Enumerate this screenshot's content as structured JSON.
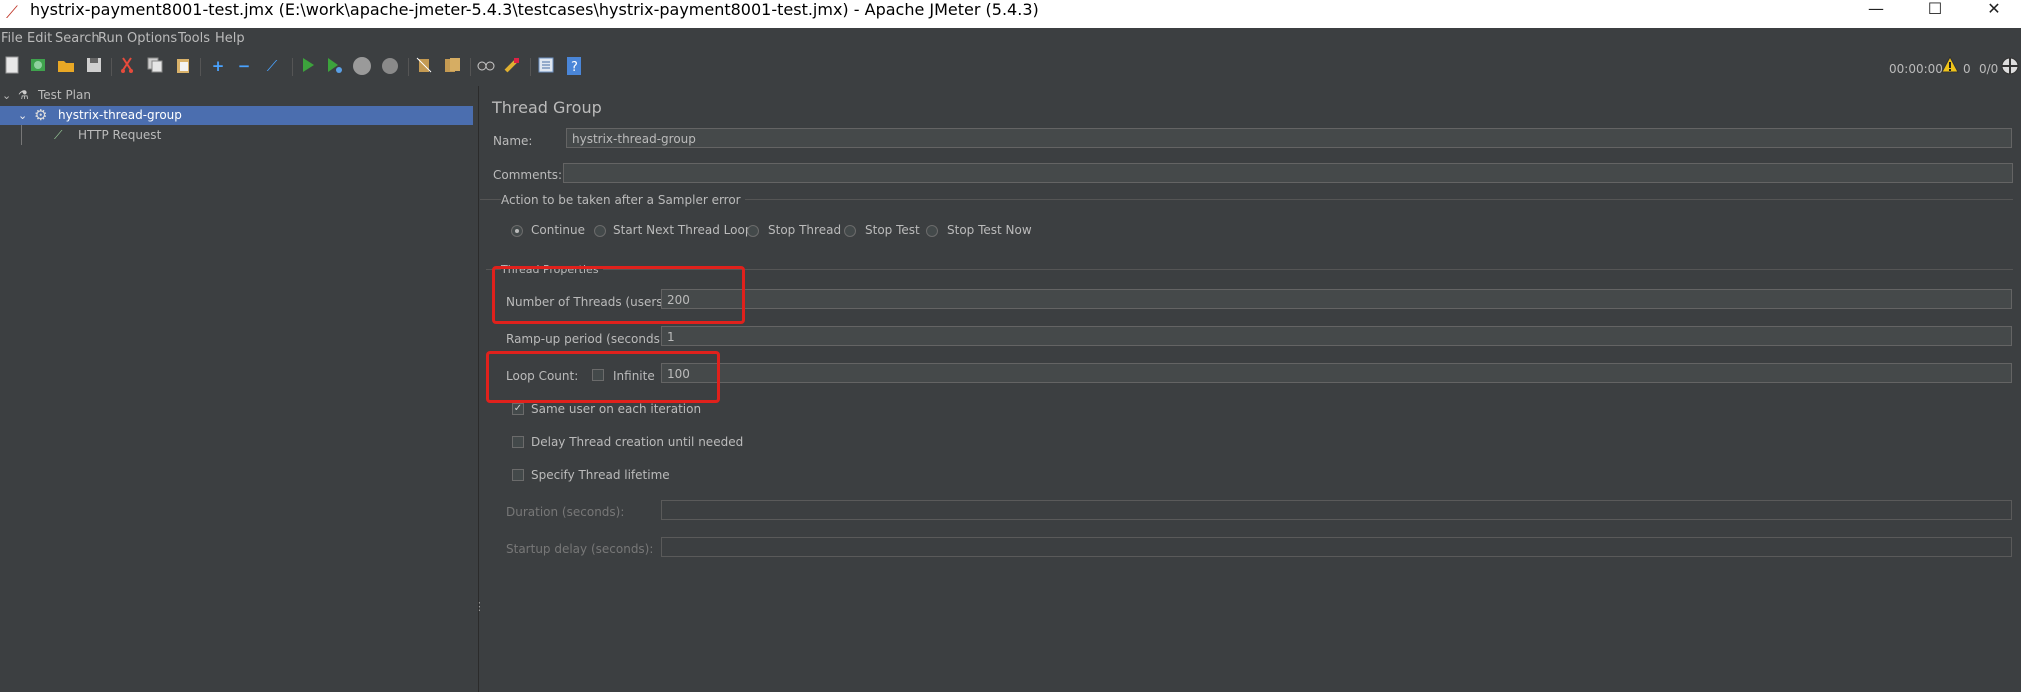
{
  "window": {
    "title": "hystrix-payment8001-test.jmx (E:\\work\\apache-jmeter-5.4.3\\testcases\\hystrix-payment8001-test.jmx) - Apache JMeter (5.4.3)",
    "minimize": "—",
    "maximize": "☐",
    "close": "✕"
  },
  "menu": {
    "file": "File",
    "edit": "Edit",
    "search": "Search",
    "run": "Run",
    "options": "Options",
    "tools": "Tools",
    "help": "Help"
  },
  "toolbar": {
    "icons": [
      "new-icon",
      "templates-icon",
      "open-icon",
      "save-icon",
      "cut-icon",
      "copy-icon",
      "paste-icon",
      "expand-icon",
      "collapse-icon",
      "toggle-icon",
      "start-icon",
      "start-no-pauses-icon",
      "stop-icon",
      "shutdown-icon",
      "clear-icon",
      "clear-all-icon",
      "search-icon",
      "reset-search-icon",
      "function-helper-icon",
      "help-icon"
    ],
    "timer": "00:00:00",
    "warning_count": "0",
    "threads": "0/0"
  },
  "tree": {
    "items": [
      {
        "label": "Test Plan"
      },
      {
        "label": "hystrix-thread-group"
      },
      {
        "label": "HTTP Request"
      }
    ]
  },
  "panel": {
    "title": "Thread Group",
    "name_label": "Name:",
    "name_value": "hystrix-thread-group",
    "comments_label": "Comments:",
    "comments_value": "",
    "action_title": "Action to be taken after a Sampler error",
    "actions": [
      "Continue",
      "Start Next Thread Loop",
      "Stop Thread",
      "Stop Test",
      "Stop Test Now"
    ],
    "selected_action": "Continue",
    "thread_props_title": "Thread Properties",
    "threads_label": "Number of Threads (users):",
    "threads_value": "200",
    "rampup_label": "Ramp-up period (seconds):",
    "rampup_value": "1",
    "loop_label": "Loop Count:",
    "infinite_label": "Infinite",
    "loop_value": "100",
    "same_user_label": "Same user on each iteration",
    "delay_label": "Delay Thread creation until needed",
    "lifetime_label": "Specify Thread lifetime",
    "duration_label": "Duration (seconds):",
    "duration_value": "",
    "startup_label": "Startup delay (seconds):",
    "startup_value": ""
  }
}
